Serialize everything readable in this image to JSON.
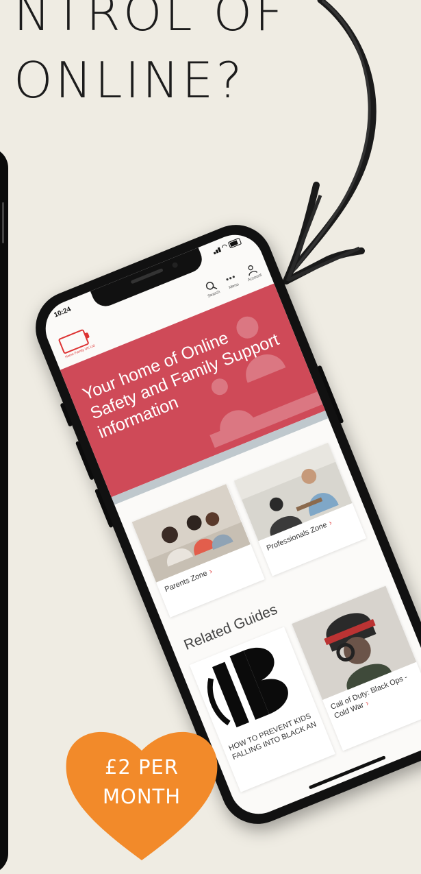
{
  "headline": {
    "line1": "NTROL OF",
    "line2": "ONLINE?"
  },
  "phone": {
    "status_time": "10:24",
    "appbar": {
      "logo_text": "Home Family UK Ltd",
      "search_label": "Search",
      "menu_label": "Menu",
      "account_label": "Account"
    },
    "hero_text": "Your home of Online Safety and Family Support information",
    "zones": [
      {
        "label": "Parents Zone"
      },
      {
        "label": "Professionals Zone"
      }
    ],
    "related_title": "Related Guides",
    "guides": [
      {
        "label": "HOW TO PREVENT KIDS FALLING INTO BLACK AN"
      },
      {
        "label": "Call of Duty: Black Ops - Cold War"
      }
    ]
  },
  "badge": {
    "line1": "£2 PER",
    "line2": "MONTH"
  },
  "colors": {
    "background": "#efece3",
    "hero": "#cf4a58",
    "accent": "#d33",
    "badge": "#f28a2a"
  }
}
